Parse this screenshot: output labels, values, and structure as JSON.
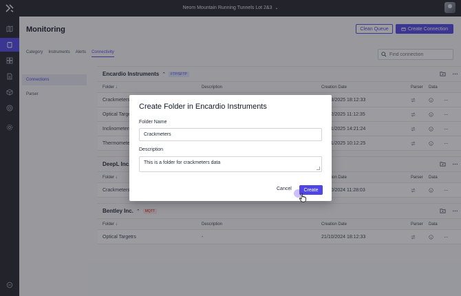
{
  "topbar": {
    "project_name": "Neom Mountain Running Tunnels Lot 2&3"
  },
  "page": {
    "title": "Monitoring"
  },
  "actions": {
    "clean_queue": "Clean Queue",
    "create_connection": "Create Connection"
  },
  "tabs": [
    {
      "label": "Category",
      "active": false
    },
    {
      "label": "Instruments",
      "active": false
    },
    {
      "label": "Alerts",
      "active": false
    },
    {
      "label": "Connectivity",
      "active": true
    }
  ],
  "search": {
    "placeholder": "Find connection"
  },
  "subnav": [
    {
      "label": "Connections",
      "active": true
    },
    {
      "label": "Parser",
      "active": false
    }
  ],
  "columns": {
    "folder": "Folder",
    "description": "Description",
    "creation_date": "Creation Date",
    "parser": "Parser",
    "data": "Data"
  },
  "groups": [
    {
      "name": "Encardio Instruments",
      "badge": "FTP/SFTP",
      "rows": [
        {
          "folder": "Crackmeters",
          "description": "",
          "date": "21/03/2025 18:12:33"
        },
        {
          "folder": "Optical Targets",
          "description": "",
          "date": "21/02/2025 11:12:35"
        },
        {
          "folder": "Inclinometers",
          "description": "",
          "date": "21/01/2025 14:21:24"
        },
        {
          "folder": "Thermometers",
          "description": "",
          "date": "21/01/2025 10:12:25"
        }
      ]
    },
    {
      "name": "DeepL Inc.",
      "badge": "",
      "rows": [
        {
          "folder": "Crackmeters",
          "description": "",
          "date": "21/10/2024 11:28:03"
        }
      ]
    },
    {
      "name": "Bentley Inc.",
      "badge": "MQTT",
      "rows": [
        {
          "folder": "Optical Targetrs",
          "description": "-",
          "date": "21/10/2024 18:12:33"
        }
      ]
    }
  ],
  "modal": {
    "title": "Create Folder in Encardio Instruments",
    "folder_name_label": "Folder Name",
    "folder_name_value": "Crackmeters",
    "description_label": "Description",
    "description_value": "This is a folder for crackmeters data",
    "cancel_label": "Cancel",
    "create_label": "Create"
  }
}
